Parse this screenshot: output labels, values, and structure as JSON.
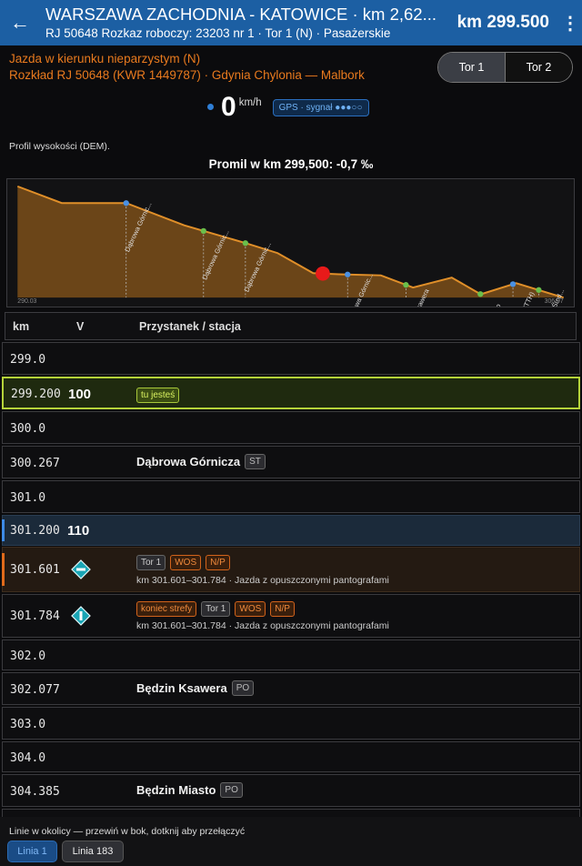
{
  "appbar": {
    "title": "WARSZAWA ZACHODNIA - KATOWICE · km 2,62...",
    "subtitle": "RJ 50648 Rozkaz roboczy: 23203 nr 1 · Tor 1 (N) · Pasażerskie",
    "km_now": "km 299.500"
  },
  "info": {
    "direction": "Jazda w kierunku nieparzystym (N)",
    "schedule": "Rozkład RJ 50648 (KWR 1449787) · Gdynia Chylonia — Malbork"
  },
  "tracks": {
    "tor1": "Tor 1",
    "tor2": "Tor 2",
    "selected": "Tor 1"
  },
  "speed": {
    "value": "0",
    "unit": "km/h",
    "gps": "GPS · sygnał ●●●○○"
  },
  "profile": {
    "heading": "Profil wysokości (DEM).",
    "gradient": "Promil w km 299,500: -0,7 ‰"
  },
  "chart_data": {
    "type": "area",
    "x_start_label": "290.03",
    "x_end_label": "306.97",
    "xlim": [
      290.03,
      306.97
    ],
    "current_km": 299.5,
    "elevation_profile": {
      "x": [
        290.03,
        291.4,
        293.4,
        295.2,
        297.1,
        298.1,
        299.2,
        300.0,
        301.3,
        302.3,
        303.5,
        304.4,
        305.5,
        306.97
      ],
      "y": [
        100,
        85,
        85,
        65,
        49,
        40,
        22,
        21,
        20,
        9,
        18,
        3,
        13,
        0
      ]
    },
    "stations": [
      {
        "km": 293.4,
        "label": "Dąbrowa Górnic...",
        "type": "blue"
      },
      {
        "km": 295.8,
        "label": "Dąbrowa Górnic...",
        "type": "green"
      },
      {
        "km": 297.1,
        "label": "Dąbrowa Górnic...",
        "type": "green"
      },
      {
        "km": 300.27,
        "label": "Dąbrowa Górnic...",
        "type": "blue"
      },
      {
        "km": 302.08,
        "label": "Będzin Ksawera",
        "type": "green"
      },
      {
        "km": 304.39,
        "label": "Będzin Miasto",
        "type": "green"
      },
      {
        "km": 305.4,
        "label": "Będzin (STTH)",
        "type": "blue"
      },
      {
        "km": 306.2,
        "label": "Sosnowiec Środ...",
        "type": "green"
      }
    ],
    "colors": {
      "fill": "#6b4518",
      "line": "#e08f29",
      "marker": "#e81a1a",
      "blue": "#4a90e2",
      "green": "#6abf4b"
    }
  },
  "table": {
    "headers": {
      "km": "km",
      "v": "V",
      "station": "Przystanek / stacja"
    },
    "rows": [
      {
        "km": "299.0"
      },
      {
        "km": "299.200",
        "v": "100",
        "badge": "tu jesteś"
      },
      {
        "km": "300.0"
      },
      {
        "km": "300.267",
        "name": "Dąbrowa Górnicza",
        "tag": "ST"
      },
      {
        "km": "301.0"
      },
      {
        "km": "301.200",
        "v": "110"
      },
      {
        "km": "301.601",
        "tags": [
          "Tor 1",
          "WOS",
          "N/P"
        ],
        "desc": "km 301.601–301.784 · Jazda z opuszczonymi pantografami"
      },
      {
        "km": "301.784",
        "tags": [
          "koniec strefy",
          "Tor 1",
          "WOS",
          "N/P"
        ],
        "desc": "km 301.601–301.784 · Jazda z opuszczonymi pantografami"
      },
      {
        "km": "302.0"
      },
      {
        "km": "302.077",
        "name": "Będzin Ksawera",
        "tag": "PO"
      },
      {
        "km": "303.0"
      },
      {
        "km": "304.0"
      },
      {
        "km": "304.385",
        "name": "Będzin Miasto",
        "tag": "PO"
      }
    ]
  },
  "footer": {
    "hint": "Linie w okolicy — przewiń w bok, dotknij aby przełączyć",
    "line1": "Linia 1",
    "line2": "Linia 183"
  }
}
